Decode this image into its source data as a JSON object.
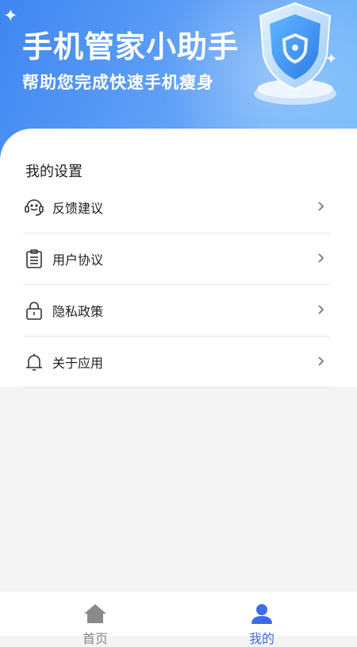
{
  "hero": {
    "title": "手机管家小助手",
    "subtitle": "帮助您完成快速手机瘦身"
  },
  "settings": {
    "title": "我的设置",
    "items": [
      {
        "label": "反馈建议",
        "icon": "headset-icon"
      },
      {
        "label": "用户协议",
        "icon": "clipboard-icon"
      },
      {
        "label": "隐私政策",
        "icon": "lock-icon"
      },
      {
        "label": "关于应用",
        "icon": "bell-icon"
      }
    ]
  },
  "tabbar": {
    "tabs": [
      {
        "label": "首页",
        "icon": "home-icon",
        "active": false
      },
      {
        "label": "我的",
        "icon": "user-icon",
        "active": true
      }
    ]
  },
  "colors": {
    "accent": "#3c6de8",
    "inactive": "#888888",
    "hero_start": "#3f86f2",
    "hero_end": "#7cc0fb"
  }
}
